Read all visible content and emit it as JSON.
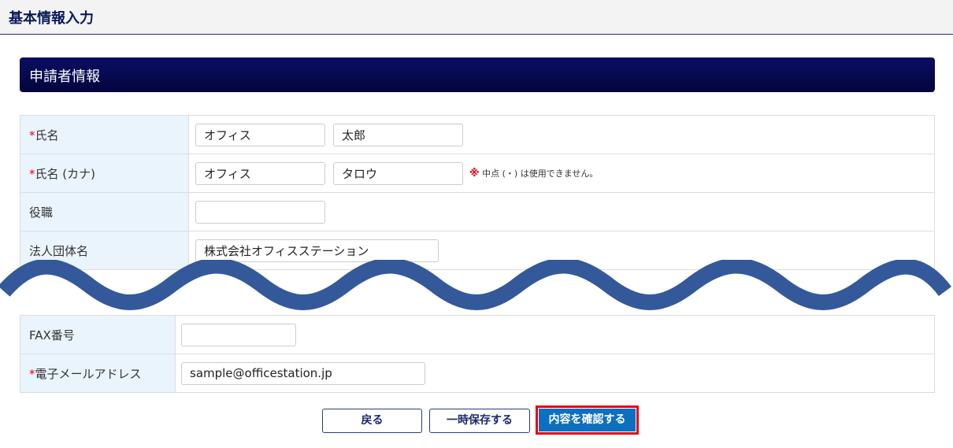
{
  "header": {
    "title": "基本情報入力"
  },
  "section": {
    "title": "申請者情報"
  },
  "required_mark": "*",
  "form_top": {
    "name": {
      "label": "氏名",
      "last": "オフィス",
      "first": "太郎"
    },
    "kana": {
      "label": "氏名 (カナ)",
      "last": "オフィス",
      "first": "タロウ",
      "note_mark": "※",
      "note": "中点 (・) は使用できません。"
    },
    "position": {
      "label": "役職",
      "value": ""
    },
    "company": {
      "label": "法人団体名",
      "value": "株式会社オフィスステーション"
    }
  },
  "form_bottom": {
    "fax": {
      "label": "FAX番号",
      "value": ""
    },
    "email": {
      "label": "電子メールアドレス",
      "value": "sample@officestation.jp"
    }
  },
  "buttons": {
    "back": "戻る",
    "save": "一時保存する",
    "confirm": "内容を確認する"
  },
  "colors": {
    "section_bar": "#03053d",
    "label_bg": "#eaf4fd",
    "required": "#e60012",
    "confirm_button": "#0d6fc0",
    "wave": "#34599a"
  }
}
